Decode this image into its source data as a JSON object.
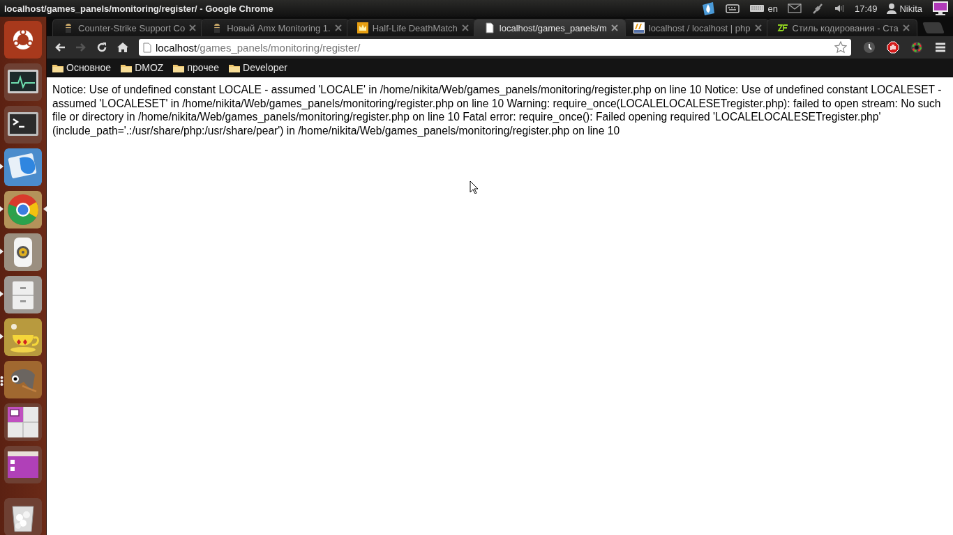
{
  "top_panel": {
    "window_title": "localhost/games_panels/monitoring/register/ - Google Chrome",
    "keyboard_layout": "en",
    "clock": "17:49",
    "user": "Nikita"
  },
  "launcher": {
    "items": [
      {
        "running": false,
        "several_windows": false,
        "focused": false
      },
      {
        "running": false,
        "several_windows": false,
        "focused": false
      },
      {
        "running": false,
        "several_windows": false,
        "focused": false
      },
      {
        "running": true,
        "several_windows": false,
        "focused": false
      },
      {
        "running": true,
        "several_windows": false,
        "focused": true
      },
      {
        "running": true,
        "several_windows": false,
        "focused": false
      },
      {
        "running": true,
        "several_windows": false,
        "focused": false
      },
      {
        "running": true,
        "several_windows": false,
        "focused": false
      },
      {
        "running": true,
        "several_windows": true,
        "focused": false
      },
      {
        "running": false,
        "several_windows": false,
        "focused": false
      },
      {
        "running": false,
        "several_windows": false,
        "focused": false
      },
      {
        "running": false,
        "several_windows": false,
        "focused": false
      }
    ]
  },
  "tabs": [
    {
      "title": "Counter-Strike Support Co",
      "selected": false
    },
    {
      "title": "Новый Amx Monitoring 1.",
      "selected": false
    },
    {
      "title": "Half-Life DeathMatch",
      "selected": false
    },
    {
      "title": "localhost/games_panels/m",
      "selected": true
    },
    {
      "title": "localhost / localhost | php",
      "selected": false
    },
    {
      "title": "Стиль кодирования - Ста",
      "selected": false
    }
  ],
  "toolbar": {
    "nav": [
      {
        "disabled": false
      },
      {
        "disabled": true
      },
      {
        "disabled": false
      },
      {
        "disabled": false
      }
    ],
    "address": {
      "host": "localhost",
      "path": "/games_panels/monitoring/register/"
    }
  },
  "bookmarks": [
    "Основное",
    "DMOZ",
    "прочее",
    "Developer"
  ],
  "page": {
    "text": "Notice: Use of undefined constant LOCALE - assumed 'LOCALE' in /home/nikita/Web/games_panels/monitoring/register.php on line 10 Notice: Use of undefined constant LOCALESET - assumed 'LOCALESET' in /home/nikita/Web/games_panels/monitoring/register.php on line 10 Warning: require_once(LOCALELOCALESETregister.php): failed to open stream: No such file or directory in /home/nikita/Web/games_panels/monitoring/register.php on line 10 Fatal error: require_once(): Failed opening required 'LOCALELOCALESETregister.php' (include_path='.:/usr/share/php:/usr/share/pear') in /home/nikita/Web/games_panels/monitoring/register.php on line 10"
  }
}
